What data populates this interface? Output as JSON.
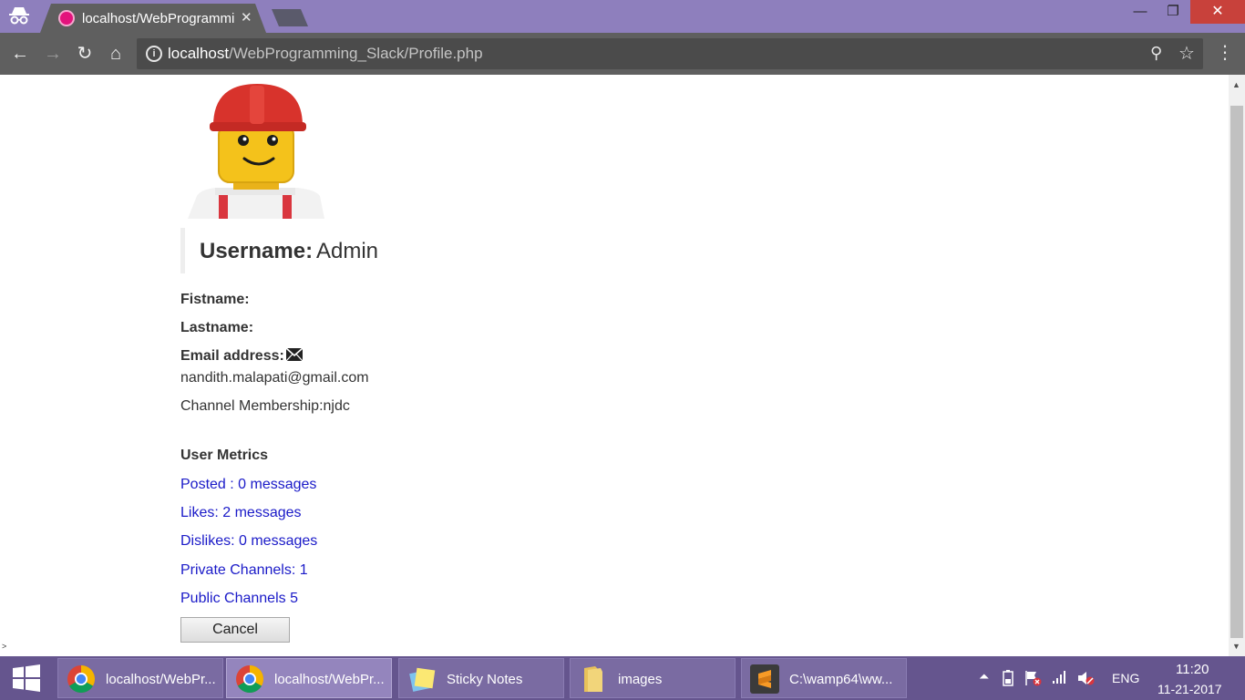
{
  "browser": {
    "tab_title": "localhost/WebProgramming_Slack/Profile.php",
    "tab_close": "✕",
    "url_host": "localhost",
    "url_path": "/WebProgramming_Slack/Profile.php",
    "info_glyph": "i",
    "window_min": "—",
    "window_max": "❐",
    "window_close": "✕"
  },
  "icons": {
    "incognito": "incognito-icon",
    "favicon": "site-favicon",
    "back": "←",
    "forward": "→",
    "reload": "↻",
    "home": "⌂",
    "zoom": "⚲",
    "star": "☆",
    "menu": "⋮"
  },
  "profile": {
    "username_label": "Username:",
    "username_value": "Admin",
    "firstname_label": "Fistname:",
    "lastname_label": "Lastname:",
    "email_label": "Email address:",
    "email_value": "nandith.malapati@gmail.com",
    "channel_membership": "Channel Membership:njdc",
    "metrics_title": "User Metrics",
    "metrics": [
      "Posted : 0 messages",
      "Likes: 2 messages",
      "Dislikes: 0 messages",
      "Private Channels: 1",
      "Public Channels 5"
    ],
    "cancel_label": "Cancel"
  },
  "page_misc": {
    "stray_caret": ">"
  },
  "scrollbar": {
    "up": "▲",
    "down": "▼"
  },
  "taskbar": {
    "tasks": [
      "localhost/WebPr...",
      "localhost/WebPr...",
      "Sticky Notes",
      "images",
      "C:\\wamp64\\ww..."
    ],
    "tray_chevron": "⏶",
    "language": "ENG",
    "time": "11:20",
    "date": "11-21-2017"
  },
  "colors": {
    "titlebar": "#8e7fbd",
    "toolbar": "#5f5f5f",
    "taskbar": "#65558e",
    "link": "#1a1ac8",
    "close_button": "#c8413b"
  }
}
